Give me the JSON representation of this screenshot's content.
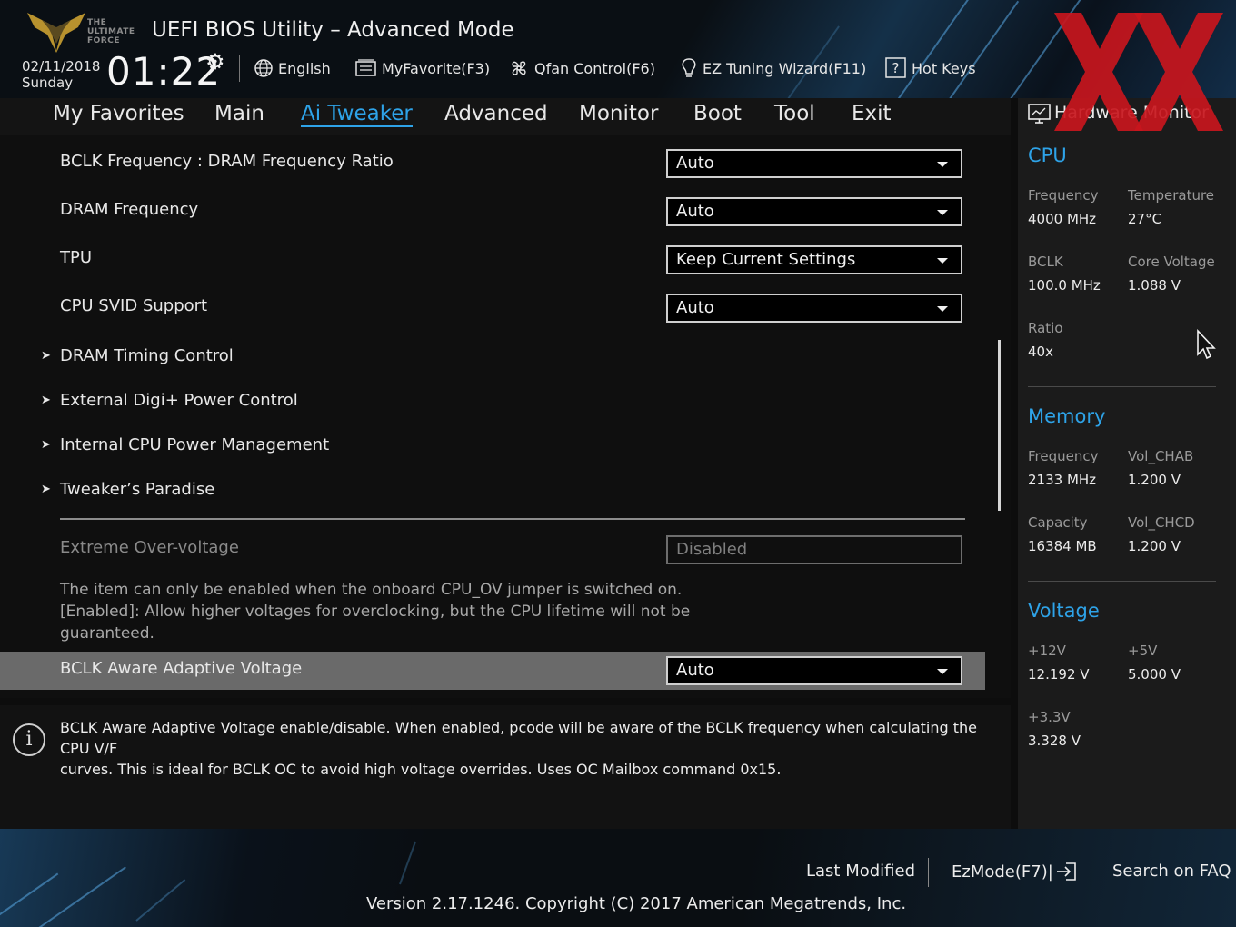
{
  "header": {
    "logo_text": [
      "THE",
      "ULTIMATE",
      "FORCE"
    ],
    "title": "UEFI BIOS Utility – Advanced Mode",
    "date": "02/11/2018",
    "weekday": "Sunday",
    "time": "01:22",
    "toolbar": [
      {
        "label": "English",
        "icon": "globe-icon"
      },
      {
        "label": "MyFavorite(F3)",
        "icon": "favorite-list-icon"
      },
      {
        "label": "Qfan Control(F6)",
        "icon": "fan-icon"
      },
      {
        "label": "EZ Tuning Wizard(F11)",
        "icon": "lightbulb-icon"
      },
      {
        "label": "Hot Keys",
        "icon": "question-box-icon"
      }
    ]
  },
  "tabs": [
    {
      "label": "My Favorites",
      "active": false
    },
    {
      "label": "Main",
      "active": false
    },
    {
      "label": "Ai Tweaker",
      "active": true
    },
    {
      "label": "Advanced",
      "active": false
    },
    {
      "label": "Monitor",
      "active": false
    },
    {
      "label": "Boot",
      "active": false
    },
    {
      "label": "Tool",
      "active": false
    },
    {
      "label": "Exit",
      "active": false
    }
  ],
  "settings": [
    {
      "label": "BCLK Frequency : DRAM Frequency Ratio",
      "value": "Auto"
    },
    {
      "label": "DRAM Frequency",
      "value": "Auto"
    },
    {
      "label": "TPU",
      "value": "Keep Current Settings"
    },
    {
      "label": "CPU SVID Support",
      "value": "Auto"
    }
  ],
  "submenus": [
    "DRAM Timing Control",
    "External Digi+ Power Control",
    "Internal CPU Power Management",
    "Tweaker’s Paradise"
  ],
  "extreme": {
    "label": "Extreme Over-voltage",
    "value": "Disabled",
    "help": [
      "The item can only be enabled when the onboard CPU_OV jumper is switched on.",
      "[Enabled]: Allow higher voltages for overclocking, but the CPU lifetime will not be",
      "guaranteed."
    ]
  },
  "selected": {
    "label": "BCLK Aware Adaptive Voltage",
    "value": "Auto"
  },
  "info": {
    "lines": [
      "BCLK Aware Adaptive Voltage enable/disable. When enabled, pcode will be aware of the BCLK frequency when calculating the CPU V/F",
      "curves. This is ideal for BCLK OC to avoid high voltage overrides. Uses OC Mailbox command 0x15."
    ]
  },
  "hwmon": {
    "title": "Hardware Monitor",
    "cpu": {
      "heading": "CPU",
      "frequency_label": "Frequency",
      "frequency": "4000 MHz",
      "temperature_label": "Temperature",
      "temperature": "27°C",
      "bclk_label": "BCLK",
      "bclk": "100.0 MHz",
      "core_voltage_label": "Core Voltage",
      "core_voltage": "1.088 V",
      "ratio_label": "Ratio",
      "ratio": "40x"
    },
    "memory": {
      "heading": "Memory",
      "frequency_label": "Frequency",
      "frequency": "2133 MHz",
      "vol_chab_label": "Vol_CHAB",
      "vol_chab": "1.200 V",
      "capacity_label": "Capacity",
      "capacity": "16384 MB",
      "vol_chcd_label": "Vol_CHCD",
      "vol_chcd": "1.200 V"
    },
    "voltage": {
      "heading": "Voltage",
      "v12_label": "+12V",
      "v12": "12.192 V",
      "v5_label": "+5V",
      "v5": "5.000 V",
      "v33_label": "+3.3V",
      "v33": "3.328 V"
    }
  },
  "footer": {
    "last_modified": "Last Modified",
    "ezmode": "EzMode(F7)|",
    "search_faq": "Search on FAQ",
    "version": "Version 2.17.1246. Copyright (C) 2017 American Megatrends, Inc."
  },
  "colors": {
    "accent": "#2ea3e8",
    "selected_row": "#6a6a6a",
    "watermark": "#c8161d"
  }
}
